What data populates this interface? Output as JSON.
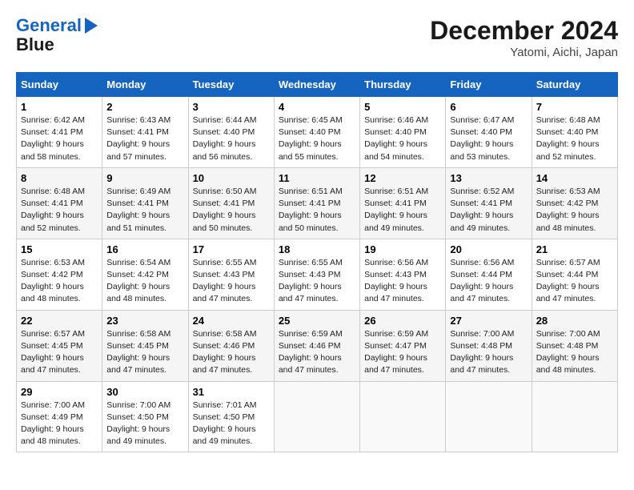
{
  "header": {
    "logo_line1": "General",
    "logo_line2": "Blue",
    "month": "December 2024",
    "location": "Yatomi, Aichi, Japan"
  },
  "weekdays": [
    "Sunday",
    "Monday",
    "Tuesday",
    "Wednesday",
    "Thursday",
    "Friday",
    "Saturday"
  ],
  "weeks": [
    [
      {
        "day": "1",
        "sunrise": "6:42 AM",
        "sunset": "4:41 PM",
        "daylight": "9 hours and 58 minutes."
      },
      {
        "day": "2",
        "sunrise": "6:43 AM",
        "sunset": "4:41 PM",
        "daylight": "9 hours and 57 minutes."
      },
      {
        "day": "3",
        "sunrise": "6:44 AM",
        "sunset": "4:40 PM",
        "daylight": "9 hours and 56 minutes."
      },
      {
        "day": "4",
        "sunrise": "6:45 AM",
        "sunset": "4:40 PM",
        "daylight": "9 hours and 55 minutes."
      },
      {
        "day": "5",
        "sunrise": "6:46 AM",
        "sunset": "4:40 PM",
        "daylight": "9 hours and 54 minutes."
      },
      {
        "day": "6",
        "sunrise": "6:47 AM",
        "sunset": "4:40 PM",
        "daylight": "9 hours and 53 minutes."
      },
      {
        "day": "7",
        "sunrise": "6:48 AM",
        "sunset": "4:40 PM",
        "daylight": "9 hours and 52 minutes."
      }
    ],
    [
      {
        "day": "8",
        "sunrise": "6:48 AM",
        "sunset": "4:41 PM",
        "daylight": "9 hours and 52 minutes."
      },
      {
        "day": "9",
        "sunrise": "6:49 AM",
        "sunset": "4:41 PM",
        "daylight": "9 hours and 51 minutes."
      },
      {
        "day": "10",
        "sunrise": "6:50 AM",
        "sunset": "4:41 PM",
        "daylight": "9 hours and 50 minutes."
      },
      {
        "day": "11",
        "sunrise": "6:51 AM",
        "sunset": "4:41 PM",
        "daylight": "9 hours and 50 minutes."
      },
      {
        "day": "12",
        "sunrise": "6:51 AM",
        "sunset": "4:41 PM",
        "daylight": "9 hours and 49 minutes."
      },
      {
        "day": "13",
        "sunrise": "6:52 AM",
        "sunset": "4:41 PM",
        "daylight": "9 hours and 49 minutes."
      },
      {
        "day": "14",
        "sunrise": "6:53 AM",
        "sunset": "4:42 PM",
        "daylight": "9 hours and 48 minutes."
      }
    ],
    [
      {
        "day": "15",
        "sunrise": "6:53 AM",
        "sunset": "4:42 PM",
        "daylight": "9 hours and 48 minutes."
      },
      {
        "day": "16",
        "sunrise": "6:54 AM",
        "sunset": "4:42 PM",
        "daylight": "9 hours and 48 minutes."
      },
      {
        "day": "17",
        "sunrise": "6:55 AM",
        "sunset": "4:43 PM",
        "daylight": "9 hours and 47 minutes."
      },
      {
        "day": "18",
        "sunrise": "6:55 AM",
        "sunset": "4:43 PM",
        "daylight": "9 hours and 47 minutes."
      },
      {
        "day": "19",
        "sunrise": "6:56 AM",
        "sunset": "4:43 PM",
        "daylight": "9 hours and 47 minutes."
      },
      {
        "day": "20",
        "sunrise": "6:56 AM",
        "sunset": "4:44 PM",
        "daylight": "9 hours and 47 minutes."
      },
      {
        "day": "21",
        "sunrise": "6:57 AM",
        "sunset": "4:44 PM",
        "daylight": "9 hours and 47 minutes."
      }
    ],
    [
      {
        "day": "22",
        "sunrise": "6:57 AM",
        "sunset": "4:45 PM",
        "daylight": "9 hours and 47 minutes."
      },
      {
        "day": "23",
        "sunrise": "6:58 AM",
        "sunset": "4:45 PM",
        "daylight": "9 hours and 47 minutes."
      },
      {
        "day": "24",
        "sunrise": "6:58 AM",
        "sunset": "4:46 PM",
        "daylight": "9 hours and 47 minutes."
      },
      {
        "day": "25",
        "sunrise": "6:59 AM",
        "sunset": "4:46 PM",
        "daylight": "9 hours and 47 minutes."
      },
      {
        "day": "26",
        "sunrise": "6:59 AM",
        "sunset": "4:47 PM",
        "daylight": "9 hours and 47 minutes."
      },
      {
        "day": "27",
        "sunrise": "7:00 AM",
        "sunset": "4:48 PM",
        "daylight": "9 hours and 47 minutes."
      },
      {
        "day": "28",
        "sunrise": "7:00 AM",
        "sunset": "4:48 PM",
        "daylight": "9 hours and 48 minutes."
      }
    ],
    [
      {
        "day": "29",
        "sunrise": "7:00 AM",
        "sunset": "4:49 PM",
        "daylight": "9 hours and 48 minutes."
      },
      {
        "day": "30",
        "sunrise": "7:00 AM",
        "sunset": "4:50 PM",
        "daylight": "9 hours and 49 minutes."
      },
      {
        "day": "31",
        "sunrise": "7:01 AM",
        "sunset": "4:50 PM",
        "daylight": "9 hours and 49 minutes."
      },
      null,
      null,
      null,
      null
    ]
  ]
}
